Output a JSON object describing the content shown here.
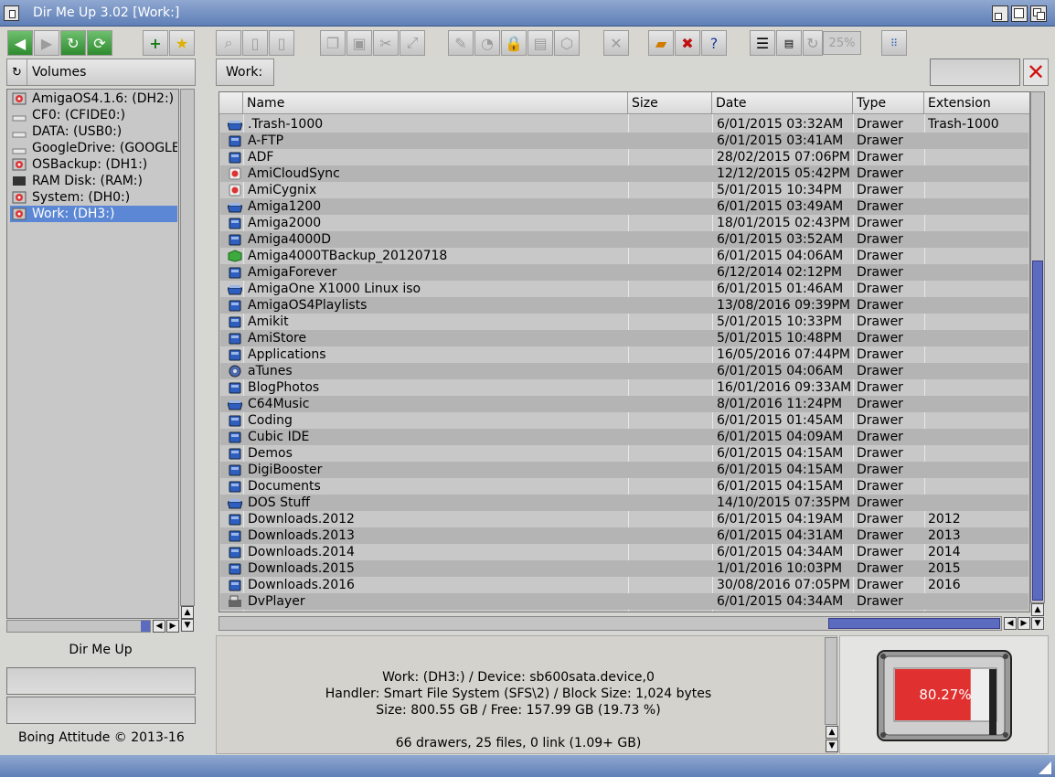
{
  "window": {
    "title": "Dir Me Up 3.02 [Work:]"
  },
  "toolbar": {
    "progress_label": "25%"
  },
  "volumes": {
    "header": "Volumes",
    "items": [
      {
        "label": "AmigaOS4.1.6: (DH2:)",
        "icon": "harddisk-icon",
        "selected": false
      },
      {
        "label": "CF0: (CFIDE0:)",
        "icon": "card-icon",
        "selected": false
      },
      {
        "label": "DATA: (USB0:)",
        "icon": "usb-drive-icon",
        "selected": false
      },
      {
        "label": "GoogleDrive: (GOOGLE",
        "icon": "cloud-drive-icon",
        "selected": false
      },
      {
        "label": "OSBackup: (DH1:)",
        "icon": "harddisk-icon",
        "selected": false
      },
      {
        "label": "RAM Disk: (RAM:)",
        "icon": "ram-disk-icon",
        "selected": false
      },
      {
        "label": "System: (DH0:)",
        "icon": "harddisk-icon",
        "selected": false
      },
      {
        "label": "Work: (DH3:)",
        "icon": "harddisk-icon",
        "selected": true
      }
    ]
  },
  "path": {
    "current": "Work:"
  },
  "filelist": {
    "columns": [
      "Name",
      "Size",
      "Date",
      "Type",
      "Extension"
    ],
    "rows": [
      {
        "name": ".Trash-1000",
        "size": "",
        "date": "6/01/2015 03:32AM",
        "type": "Drawer",
        "ext": "Trash-1000",
        "icon": "drawer-open-icon"
      },
      {
        "name": "A-FTP",
        "size": "",
        "date": "6/01/2015 03:41AM",
        "type": "Drawer",
        "ext": "",
        "icon": "drawer-icon"
      },
      {
        "name": "ADF",
        "size": "",
        "date": "28/02/2015 07:06PM",
        "type": "Drawer",
        "ext": "",
        "icon": "drawer-icon"
      },
      {
        "name": "AmiCloudSync",
        "size": "",
        "date": "12/12/2015 05:42PM",
        "type": "Drawer",
        "ext": "",
        "icon": "app-icon"
      },
      {
        "name": "AmiCygnix",
        "size": "",
        "date": "5/01/2015 10:34PM",
        "type": "Drawer",
        "ext": "",
        "icon": "app-icon"
      },
      {
        "name": "Amiga1200",
        "size": "",
        "date": "6/01/2015 03:49AM",
        "type": "Drawer",
        "ext": "",
        "icon": "drawer-open-icon"
      },
      {
        "name": "Amiga2000",
        "size": "",
        "date": "18/01/2015 02:43PM",
        "type": "Drawer",
        "ext": "",
        "icon": "drawer-icon"
      },
      {
        "name": "Amiga4000D",
        "size": "",
        "date": "6/01/2015 03:52AM",
        "type": "Drawer",
        "ext": "",
        "icon": "drawer-icon"
      },
      {
        "name": "Amiga4000TBackup_20120718",
        "size": "",
        "date": "6/01/2015 04:06AM",
        "type": "Drawer",
        "ext": "",
        "icon": "package-icon"
      },
      {
        "name": "AmigaForever",
        "size": "",
        "date": "6/12/2014 02:12PM",
        "type": "Drawer",
        "ext": "",
        "icon": "drawer-icon"
      },
      {
        "name": "AmigaOne X1000 Linux iso",
        "size": "",
        "date": "6/01/2015 01:46AM",
        "type": "Drawer",
        "ext": "",
        "icon": "drawer-open-icon"
      },
      {
        "name": "AmigaOS4Playlists",
        "size": "",
        "date": "13/08/2016 09:39PM",
        "type": "Drawer",
        "ext": "",
        "icon": "drawer-icon"
      },
      {
        "name": "Amikit",
        "size": "",
        "date": "5/01/2015 10:33PM",
        "type": "Drawer",
        "ext": "",
        "icon": "drawer-icon"
      },
      {
        "name": "AmiStore",
        "size": "",
        "date": "5/01/2015 10:48PM",
        "type": "Drawer",
        "ext": "",
        "icon": "drawer-icon"
      },
      {
        "name": "Applications",
        "size": "",
        "date": "16/05/2016 07:44PM",
        "type": "Drawer",
        "ext": "",
        "icon": "drawer-icon"
      },
      {
        "name": "aTunes",
        "size": "",
        "date": "6/01/2015 04:06AM",
        "type": "Drawer",
        "ext": "",
        "icon": "music-app-icon"
      },
      {
        "name": "BlogPhotos",
        "size": "",
        "date": "16/01/2016 09:33AM",
        "type": "Drawer",
        "ext": "",
        "icon": "drawer-icon"
      },
      {
        "name": "C64Music",
        "size": "",
        "date": "8/01/2016 11:24PM",
        "type": "Drawer",
        "ext": "",
        "icon": "drawer-open-icon"
      },
      {
        "name": "Coding",
        "size": "",
        "date": "6/01/2015 01:45AM",
        "type": "Drawer",
        "ext": "",
        "icon": "drawer-icon"
      },
      {
        "name": "Cubic IDE",
        "size": "",
        "date": "6/01/2015 04:09AM",
        "type": "Drawer",
        "ext": "",
        "icon": "drawer-icon"
      },
      {
        "name": "Demos",
        "size": "",
        "date": "6/01/2015 04:15AM",
        "type": "Drawer",
        "ext": "",
        "icon": "drawer-icon"
      },
      {
        "name": "DigiBooster",
        "size": "",
        "date": "6/01/2015 04:15AM",
        "type": "Drawer",
        "ext": "",
        "icon": "drawer-icon"
      },
      {
        "name": "Documents",
        "size": "",
        "date": "6/01/2015 04:15AM",
        "type": "Drawer",
        "ext": "",
        "icon": "drawer-icon"
      },
      {
        "name": "DOS Stuff",
        "size": "",
        "date": "14/10/2015 07:35PM",
        "type": "Drawer",
        "ext": "",
        "icon": "drawer-open-icon"
      },
      {
        "name": "Downloads.2012",
        "size": "",
        "date": "6/01/2015 04:19AM",
        "type": "Drawer",
        "ext": "2012",
        "icon": "drawer-icon"
      },
      {
        "name": "Downloads.2013",
        "size": "",
        "date": "6/01/2015 04:31AM",
        "type": "Drawer",
        "ext": "2013",
        "icon": "drawer-icon"
      },
      {
        "name": "Downloads.2014",
        "size": "",
        "date": "6/01/2015 04:34AM",
        "type": "Drawer",
        "ext": "2014",
        "icon": "drawer-icon"
      },
      {
        "name": "Downloads.2015",
        "size": "",
        "date": "1/01/2016 10:03PM",
        "type": "Drawer",
        "ext": "2015",
        "icon": "drawer-icon"
      },
      {
        "name": "Downloads.2016",
        "size": "",
        "date": "30/08/2016 07:05PM",
        "type": "Drawer",
        "ext": "2016",
        "icon": "drawer-icon"
      },
      {
        "name": "DvPlayer",
        "size": "",
        "date": "6/01/2015 04:34AM",
        "type": "Drawer",
        "ext": "",
        "icon": "video-app-icon"
      }
    ]
  },
  "left_panel": {
    "app_name": "Dir Me Up",
    "copyright": "Boing Attitude © 2013-16"
  },
  "info": {
    "line1": "Work: (DH3:) / Device: sb600sata.device,0",
    "line2": "Handler: Smart File System (SFS\\2) / Block Size: 1,024 bytes",
    "line3": "Size: 800.55 GB / Free: 157.99 GB (19.73 %)",
    "summary": "66 drawers, 25 files, 0 link (1.09+ GB)"
  },
  "gauge": {
    "label": "80.27%",
    "used_fraction": 0.8027
  },
  "colors": {
    "accent": "#5b87d4",
    "titlebar": "#6f8fc4",
    "gauge_red": "#e03030"
  }
}
